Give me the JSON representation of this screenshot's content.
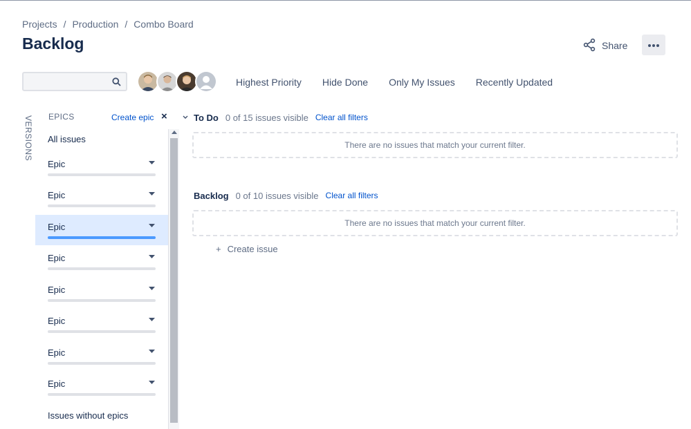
{
  "breadcrumb": {
    "items": [
      "Projects",
      "Production",
      "Combo Board"
    ],
    "separator": "/"
  },
  "page": {
    "title": "Backlog"
  },
  "header": {
    "share_label": "Share",
    "more_icon": "more-horizontal-icon",
    "share_icon": "share-icon"
  },
  "search": {
    "placeholder": "",
    "value": "",
    "icon": "search-icon"
  },
  "avatars": [
    "user-avatar-1",
    "user-avatar-2",
    "user-avatar-3",
    "default-avatar"
  ],
  "quick_filters": [
    "Highest Priority",
    "Hide Done",
    "Only My Issues",
    "Recently Updated"
  ],
  "versions_tab": {
    "label": "VERSIONS"
  },
  "epics_panel": {
    "heading": "EPICS",
    "create_label": "Create epic",
    "close_symbol": "×",
    "all_issues": "All issues",
    "epics": [
      {
        "label": "Epic",
        "selected": false
      },
      {
        "label": "Epic",
        "selected": false
      },
      {
        "label": "Epic",
        "selected": true
      },
      {
        "label": "Epic",
        "selected": false
      },
      {
        "label": "Epic",
        "selected": false
      },
      {
        "label": "Epic",
        "selected": false
      },
      {
        "label": "Epic",
        "selected": false
      },
      {
        "label": "Epic",
        "selected": false
      }
    ],
    "issues_without_epics": "Issues without epics"
  },
  "sprints": [
    {
      "name": "To Do",
      "count_text": "0 of 15 issues visible",
      "clear_label": "Clear all filters",
      "empty_text": "There are no issues that match your current filter.",
      "collapsible": true
    },
    {
      "name": "Backlog",
      "count_text": "0 of 10 issues visible",
      "clear_label": "Clear all filters",
      "empty_text": "There are no issues that match your current filter.",
      "collapsible": false
    }
  ],
  "create_issue": {
    "plus": "+",
    "label": "Create issue"
  },
  "colors": {
    "link": "#0052cc",
    "selected_bg": "#deebff",
    "title": "#172b4d",
    "muted": "#5e6c84"
  }
}
